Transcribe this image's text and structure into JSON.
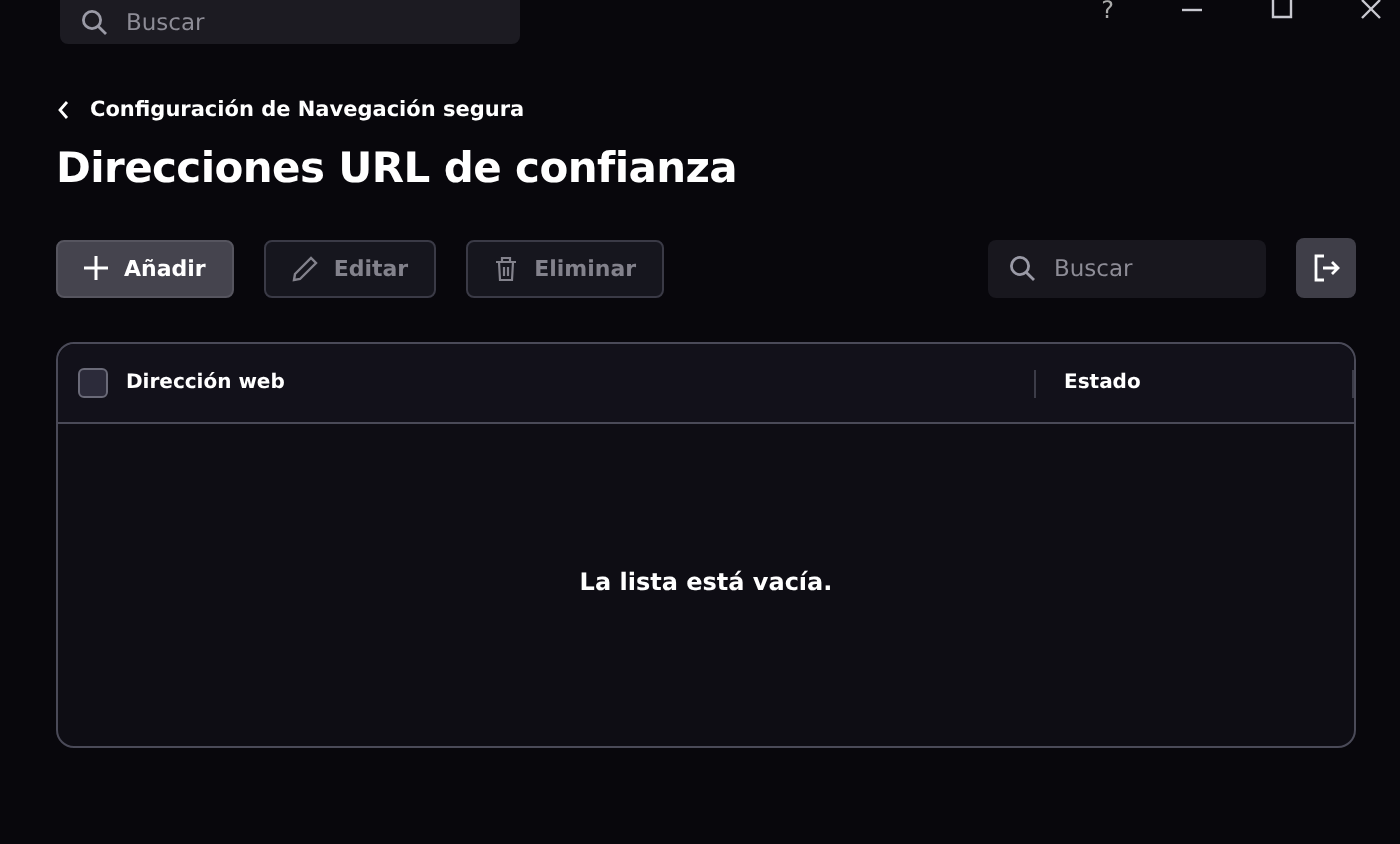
{
  "top_search": {
    "placeholder": "Buscar"
  },
  "window_controls": [
    {
      "kind": "help",
      "label": "?"
    },
    {
      "kind": "minimize"
    },
    {
      "kind": "maximize"
    },
    {
      "kind": "close"
    }
  ],
  "breadcrumb": "Configuración de Navegación segura",
  "title": "Direcciones URL de confianza",
  "toolbar": [
    {
      "kind": "add",
      "label": "Añadir",
      "disabled": false
    },
    {
      "kind": "edit",
      "label": "Editar",
      "disabled": true
    },
    {
      "kind": "delete",
      "label": "Eliminar",
      "disabled": true
    }
  ],
  "search": {
    "placeholder": "Buscar"
  },
  "table": {
    "select_all_checked": false,
    "columns": [
      "Dirección web",
      "Estado"
    ],
    "empty_message": "La lista está vacía."
  }
}
